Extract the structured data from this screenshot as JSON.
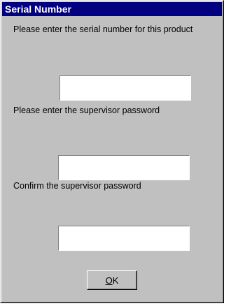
{
  "window": {
    "title": "Serial Number"
  },
  "serial": {
    "prompt": "Please enter the serial number for this product",
    "value": ""
  },
  "supervisor_password": {
    "prompt": "Please enter the supervisor password",
    "value": ""
  },
  "confirm_password": {
    "prompt": "Confirm the supervisor password",
    "value": ""
  },
  "buttons": {
    "ok_mnemonic": "O",
    "ok_rest": "K"
  },
  "colors": {
    "titlebar": "#000080",
    "face": "#c0c0c0",
    "field": "#ffffff"
  }
}
